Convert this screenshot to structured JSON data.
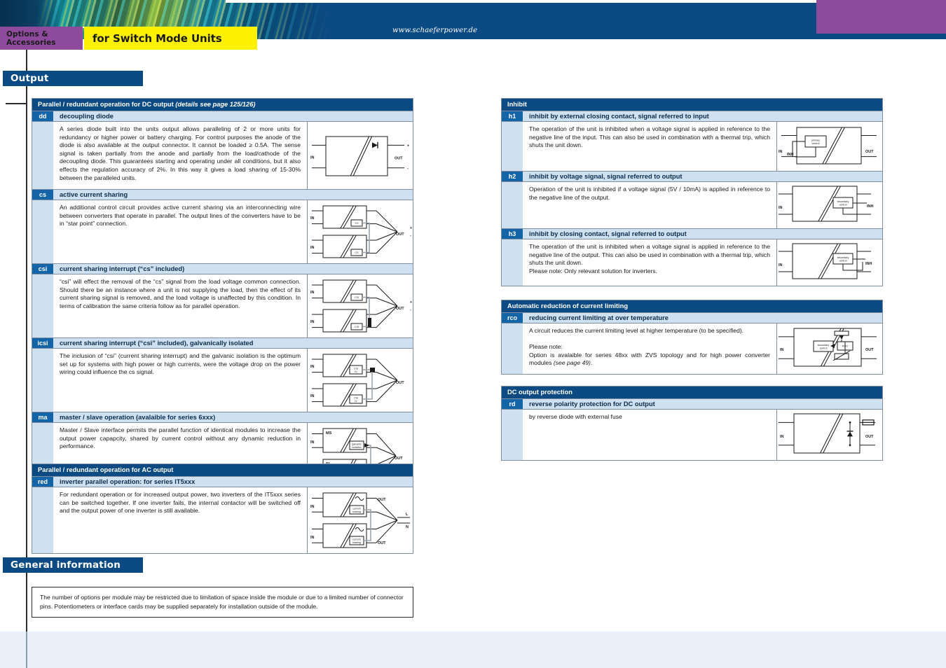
{
  "header": {
    "category_tab": "Options & Accessories",
    "title_tab": "for Switch Mode Units",
    "website": "www.schaeferpower.de"
  },
  "sections": {
    "output": "Output",
    "general": "General information"
  },
  "left_column": [
    {
      "table_title_main": "Parallel / redundant operation for DC output ",
      "table_title_italic": "(details see page 125/126)",
      "rows": [
        {
          "code": "dd",
          "title": "decoupling diode",
          "paragraphs": [
            "A series diode built into the units output allows paralleling of 2 or more units for redundancy or higher power or battery charging. For control purposes the anode of the diode is also available at the output connector. It cannot be loaded ≥ 0.5A. The sense signal is taken partially from the anode and partially from the load/cathode of the decoupling diode. This guarantees starting and operating under all conditions, but it also effects the regulation accuracy of 2%. In this way it gives a load sharing of 15-30% between the paralleled units."
          ],
          "figure": "single-converter-diode",
          "figure_labels": [
            "IN",
            "OUT",
            "+",
            "-"
          ],
          "body_height": 97
        },
        {
          "code": "cs",
          "title": "active current sharing",
          "paragraphs": [
            "An additional control circuit provides active current sharing via an interconnecting wire between converters that operate in parallel. The output lines of the converters have to be in “star point” connection."
          ],
          "figure": "two-converter-cs",
          "figure_labels": [
            "IN",
            "IN",
            "CS",
            "CS",
            "OUT"
          ],
          "body_height": 79
        },
        {
          "code": "csi",
          "title": "current sharing interrupt (“cs” included)",
          "paragraphs": [
            "“csi” will effect the removal of the “cs” signal from the load voltage common connection. Should there be an instance where a unit is not supplying the load, then the effect of its current sharing signal is removed, and the load voltage is unaffected by this condition. In terms of calibration the same criteria follow as for parallel operation."
          ],
          "figure": "two-converter-csi",
          "figure_labels": [
            "IN",
            "IN",
            "CSI",
            "CSI",
            "OUT"
          ],
          "body_height": 81
        },
        {
          "code": "icsi",
          "title": "current sharing interrupt (“csi” included), galvanically isolated",
          "paragraphs": [
            "The inclusion of “csi” (current sharing interrupt) and the galvanic isolation is the optimum set up for systems with high power or high currents, were the voltage drop on the power wiring could influence the cs signal."
          ],
          "figure": "two-converter-icsi",
          "figure_labels": [
            "IN",
            "IN",
            "CSI / IV",
            "CSI / IV",
            "OUT"
          ],
          "body_height": 81
        },
        {
          "code": "ma",
          "title": "master / slave operation (avalaible for series 6xxx)",
          "paragraphs": [
            "Master / Slave interface permits the parallel function of identical modules to increase the output power capapcity, shared by current control without any dynamic reduction in performance."
          ],
          "figure": "master-slave",
          "figure_labels": [
            "MS",
            "SL",
            "IN",
            "IN",
            "galvanic isolation",
            "galvanic isolation",
            "OUT"
          ],
          "body_height": 88
        }
      ]
    },
    {
      "table_title_main": "Parallel / redundant operation for AC output",
      "table_title_italic": "",
      "rows": [
        {
          "code": "red",
          "title": "inverter parallel operation: for series IT5xxx",
          "paragraphs": [
            "For redundant operation or for increased output power, two inverters of the IT5xxx series can be switched together. If one inverter fails, the internal contactor will be switched off and the output power of one inverter is still available."
          ],
          "figure": "inverter-parallel",
          "figure_labels": [
            "IN",
            "IN",
            "current sharing",
            "current sharing",
            "OUT",
            "OUT",
            "L",
            "N"
          ],
          "body_height": 88
        }
      ]
    }
  ],
  "right_column": [
    {
      "table_title_main": "Inhibit",
      "table_title_italic": "",
      "rows": [
        {
          "code": "h1",
          "title": "inhibit by external closing contact, signal referred to input",
          "paragraphs": [
            "The operation of the unit is inhibited when a voltage signal is applied in reference to the negative line of the input. This can also be used in combination with a thermal trip, which shuts the unit down."
          ],
          "figure": "inhibit-primary",
          "figure_labels": [
            "IN",
            "INH",
            "primary control",
            "OUT"
          ],
          "body_height": 70
        },
        {
          "code": "h2",
          "title": "inhibit by voltage signal, signal referred to output",
          "paragraphs": [
            "Operation of the unit is inhibited if a voltage signal (5V / 10mA) is applied in reference to the negative line of the output."
          ],
          "figure": "inhibit-secondary",
          "figure_labels": [
            "IN",
            "secondary control",
            "INH"
          ],
          "body_height": 65
        },
        {
          "code": "h3",
          "title": "inhibit by closing contact, signal referred to output",
          "paragraphs": [
            "The operation of the unit is inhibited when a voltage signal is applied in reference to the negative line of the output. This can also be used in combination with a thermal trip, which shuts the unit down.",
            "Please note: Only relevant solution for inverters."
          ],
          "figure": "inhibit-secondary-contact",
          "figure_labels": [
            "IN",
            "secondary control",
            "INH"
          ],
          "body_height": 66
        }
      ]
    },
    {
      "table_title_main": "Automatic reduction of current limiting",
      "table_title_italic": "",
      "rows": [
        {
          "code": "rco",
          "title": "reducing current limiting at over temperature",
          "paragraphs": [
            "A circuit reduces the current limiting level at higher temperature (to be specified).",
            "",
            "Please note:",
            "Option is avalaible for series 48xx with ZVS topology and for high power converter modules (see page 49)."
          ],
          "figure": "rco-circuit",
          "figure_labels": [
            "IN",
            "secondary control",
            "RCO",
            "OUT"
          ],
          "body_height": 72
        }
      ]
    },
    {
      "table_title_main": "DC output protection",
      "table_title_italic": "",
      "rows": [
        {
          "code": "rd",
          "title": "reverse polarity protection for DC output",
          "paragraphs": [
            "by reverse diode with external fuse"
          ],
          "figure": "reverse-diode",
          "figure_labels": [
            "IN",
            "OUT"
          ],
          "body_height": 67
        }
      ]
    }
  ],
  "general_note": "The number of options per module may be restricted due to limitation of space inside the module or due to a limited number of connector pins. Potentiometers or interface cards may be supplied separately for installation outside of the module.",
  "colors": {
    "brand_blue": "#0b4a82",
    "code_blue": "#1465a8",
    "row_light_blue": "#cfe0f0",
    "tab_yellow": "#fff200",
    "tab_purple": "#8e4b9e",
    "footer_band": "#e9f0f9"
  }
}
